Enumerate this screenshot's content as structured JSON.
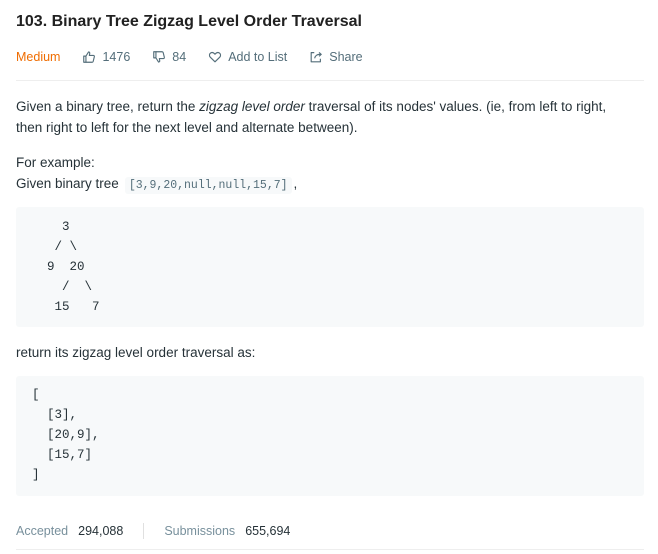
{
  "problem": {
    "title": "103. Binary Tree Zigzag Level Order Traversal",
    "difficulty": "Medium",
    "likes": "1476",
    "dislikes": "84",
    "add_to_list": "Add to List",
    "share": "Share"
  },
  "description": {
    "part1": "Given a binary tree, return the ",
    "emphasis": "zigzag level order",
    "part2": " traversal of its nodes' values. (ie, from left to right, then right to left for the next level and alternate between)."
  },
  "example": {
    "label": "For example:",
    "given_prefix": "Given binary tree",
    "given_code": "[3,9,20,null,null,15,7]",
    "given_suffix": ",",
    "tree": "    3\n   / \\\n  9  20\n    /  \\\n   15   7",
    "return_label": "return its zigzag level order traversal as:",
    "result": "[\n  [3],\n  [20,9],\n  [15,7]\n]"
  },
  "stats": {
    "accepted_label": "Accepted",
    "accepted_value": "294,088",
    "submissions_label": "Submissions",
    "submissions_value": "655,694"
  },
  "icons": {
    "like": "thumbs-up-icon",
    "dislike": "thumbs-down-icon",
    "add": "heart-icon",
    "share": "share-icon"
  },
  "colors": {
    "difficulty_medium": "#ef6c00",
    "code_background": "#f7f9fa"
  }
}
